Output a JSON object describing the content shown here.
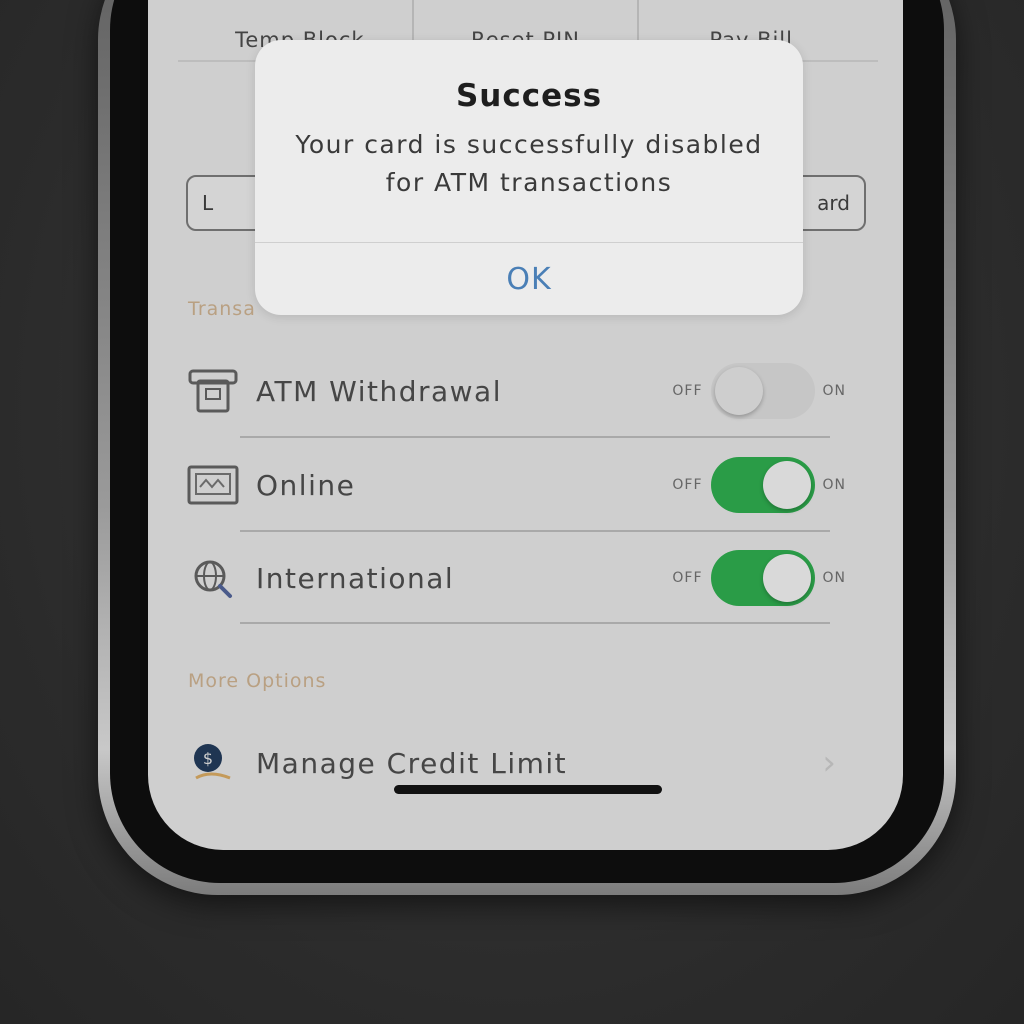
{
  "quick_actions": [
    "Temp Block",
    "Reset PIN",
    "Pay Bill"
  ],
  "card_buttons": {
    "left": "L",
    "right": "ard"
  },
  "sections": {
    "transactions_header": "Transa",
    "more_options_header": "More Options"
  },
  "toggle_labels": {
    "off": "OFF",
    "on": "ON"
  },
  "transactions": [
    {
      "label": "ATM Withdrawal",
      "icon": "atm-icon",
      "enabled": false
    },
    {
      "label": "Online",
      "icon": "online-icon",
      "enabled": true
    },
    {
      "label": "International",
      "icon": "international-icon",
      "enabled": true
    }
  ],
  "more_options": [
    {
      "label": "Manage Credit Limit",
      "icon": "credit-limit-icon"
    }
  ],
  "alert": {
    "title": "Success",
    "message": "Your card is successfully disabled for ATM transactions",
    "ok_label": "OK"
  },
  "colors": {
    "toggle_on": "#2a9c47",
    "toggle_off": "#c6c6c6",
    "alert_button": "#4a7fb6",
    "section_header": "#b9a082"
  }
}
